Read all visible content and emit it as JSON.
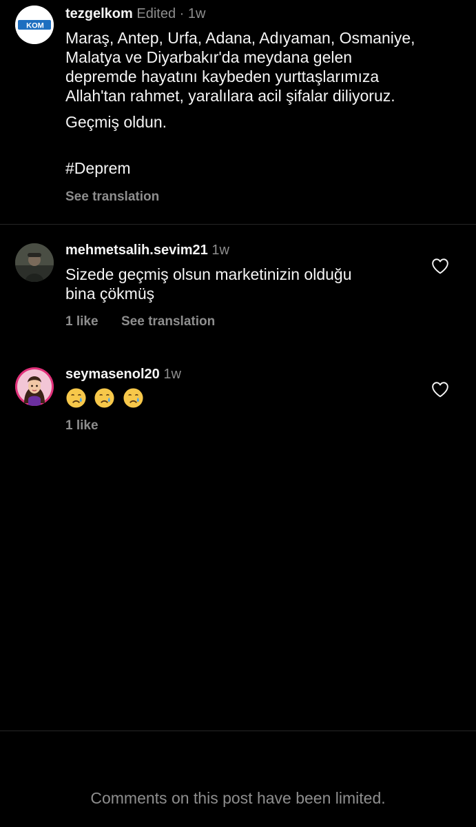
{
  "post": {
    "username": "tezgelkom",
    "edited": "Edited",
    "separator": "·",
    "time": "1w",
    "caption_lines": [
      "Maraş, Antep, Urfa, Adana, Adıyaman, Osmaniye,",
      "Malatya ve Diyarbakır'da meydana gelen",
      "depremde hayatını kaybeden yurttaşlarımıza",
      "Allah'tan rahmet, yaralılara acil şifalar diliyoruz.",
      "Geçmiş oldun."
    ],
    "hashtag": "#Deprem",
    "see_translation": "See translation",
    "avatar_logo_text": "KOM"
  },
  "comments": [
    {
      "username": "mehmetsalih.sevim21",
      "time": "1w",
      "text_lines": [
        "Sizede geçmiş olsun marketinizin olduğu",
        "bina çökmüş"
      ],
      "likes": "1 like",
      "see_translation": "See translation"
    },
    {
      "username": "seymasenol20",
      "time": "1w",
      "emojis": [
        "crying-face",
        "crying-face",
        "crying-face"
      ],
      "likes": "1 like"
    }
  ],
  "footer": {
    "limited_text": "Comments on this post have been limited."
  },
  "colors": {
    "background": "#000000",
    "text": "#f5f5f5",
    "secondary": "#8e8e8e",
    "divider": "#262626",
    "logo_blue": "#1e6fc0",
    "avatar2_ring": "#e0317a"
  }
}
